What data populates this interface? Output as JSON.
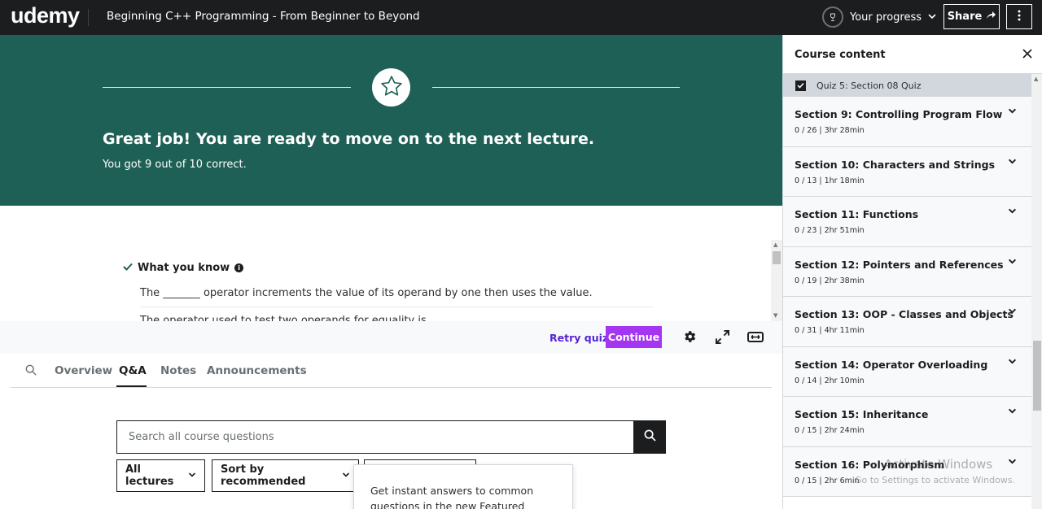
{
  "topbar": {
    "logo": "udemy",
    "course_title": "Beginning C++ Programming - From Beginner to Beyond",
    "progress_label": "Your progress",
    "share_label": "Share"
  },
  "banner": {
    "headline": "Great job! You are ready to move on to the next lecture.",
    "score_text": "You got 9 out of 10 correct."
  },
  "results": {
    "section_label": "What you know",
    "questions": [
      "The _______ operator increments the value of its operand by one then uses the value.",
      "The operator used to test two operands for equality is"
    ]
  },
  "controls": {
    "retry_label": "Retry quiz",
    "continue_label": "Continue"
  },
  "tabs": [
    {
      "label": "Overview"
    },
    {
      "label": "Q&A"
    },
    {
      "label": "Notes"
    },
    {
      "label": "Announcements"
    }
  ],
  "qa": {
    "search_placeholder": "Search all course questions",
    "filter_lectures": "All lectures",
    "filter_sort": "Sort by recommended",
    "popover_text": "Get instant answers to common questions in the new Featured"
  },
  "sidebar": {
    "title": "Course content",
    "quiz_item": "Quiz 5: Section 08 Quiz",
    "sections": [
      {
        "title": "Section 9: Controlling Program Flow",
        "meta": "0 / 26 | 3hr 28min"
      },
      {
        "title": "Section 10: Characters and Strings",
        "meta": "0 / 13 | 1hr 18min"
      },
      {
        "title": "Section 11: Functions",
        "meta": "0 / 23 | 2hr 51min"
      },
      {
        "title": "Section 12: Pointers and References",
        "meta": "0 / 19 | 2hr 38min"
      },
      {
        "title": "Section 13: OOP - Classes and Objects",
        "meta": "0 / 31 | 4hr 11min"
      },
      {
        "title": "Section 14: Operator Overloading",
        "meta": "0 / 14 | 2hr 10min"
      },
      {
        "title": "Section 15: Inheritance",
        "meta": "0 / 15 | 2hr 24min"
      },
      {
        "title": "Section 16: Polymorphism",
        "meta": "0 / 15 | 2hr 6min"
      }
    ]
  },
  "watermark": {
    "line1": "Activate Windows",
    "line2": "Go to Settings to activate Windows."
  },
  "colors": {
    "banner_bg": "#1e6055",
    "accent_purple": "#a435f0",
    "link_purple": "#5624d0",
    "dark": "#1c1d1f"
  }
}
